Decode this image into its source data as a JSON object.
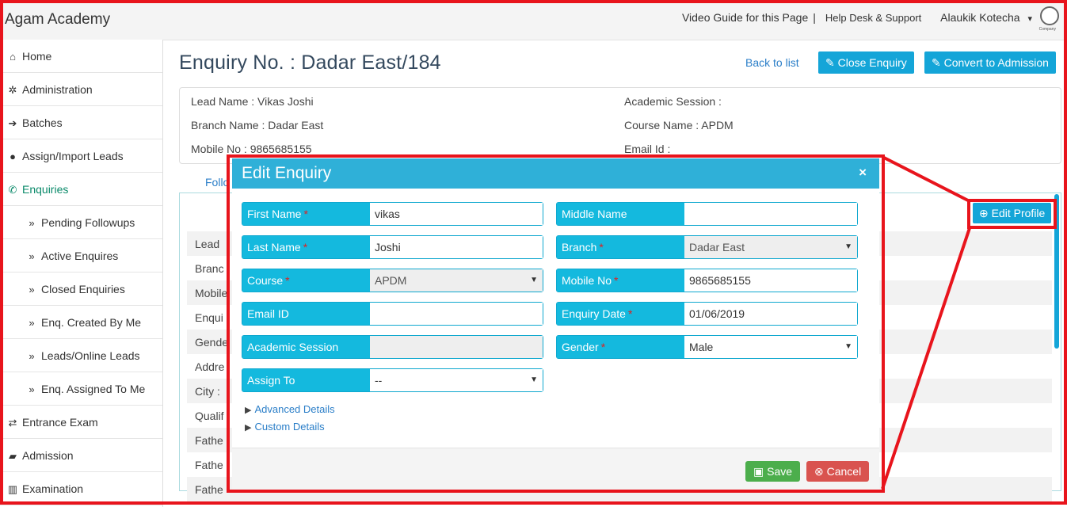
{
  "header": {
    "brand": "Agam Academy",
    "video_guide": "Video Guide for this Page",
    "separator": "|",
    "help": "Help Desk & Support",
    "user": "Alaukik Kotecha",
    "user_caret": "▾",
    "logo_caption": "Company"
  },
  "sidebar": {
    "items": [
      {
        "label": "Home",
        "icon": "home-icon",
        "glyph": "⌂"
      },
      {
        "label": "Administration",
        "icon": "gear-icon",
        "glyph": "✲"
      },
      {
        "label": "Batches",
        "icon": "sign-in-icon",
        "glyph": "➔"
      },
      {
        "label": "Assign/Import Leads",
        "icon": "user-icon",
        "glyph": "●"
      },
      {
        "label": "Enquiries",
        "icon": "phone-icon",
        "glyph": "✆"
      },
      {
        "label": "Pending Followups",
        "icon": "chevron-double-right-icon",
        "glyph": "»"
      },
      {
        "label": "Active Enquires",
        "icon": "chevron-double-right-icon",
        "glyph": "»"
      },
      {
        "label": "Closed Enquiries",
        "icon": "chevron-double-right-icon",
        "glyph": "»"
      },
      {
        "label": "Enq. Created By Me",
        "icon": "chevron-double-right-icon",
        "glyph": "»"
      },
      {
        "label": "Leads/Online Leads",
        "icon": "chevron-double-right-icon",
        "glyph": "»"
      },
      {
        "label": "Enq. Assigned To Me",
        "icon": "chevron-double-right-icon",
        "glyph": "»"
      },
      {
        "label": "Entrance Exam",
        "icon": "exchange-icon",
        "glyph": "⇄"
      },
      {
        "label": "Admission",
        "icon": "book-icon",
        "glyph": "▰"
      },
      {
        "label": "Examination",
        "icon": "bar-chart-icon",
        "glyph": "▥"
      }
    ]
  },
  "page": {
    "title": "Enquiry No. : Dadar East/184",
    "back": "Back to list",
    "close_enquiry": "Close Enquiry",
    "convert": "Convert to Admission",
    "lead_name": "Lead Name : Vikas Joshi",
    "branch_name": "Branch Name : Dadar East",
    "mobile_no": "Mobile No : 9865685155",
    "academic_session": "Academic Session :",
    "course_name": "Course Name : APDM",
    "email_id": "Email Id :",
    "tab_fragment": "Follo",
    "edit_profile": "Edit Profile",
    "row_labels": [
      "Lead",
      "Branc",
      "Mobile",
      "Enqui",
      "Gende",
      "Addre",
      "City :",
      "Qualif",
      "Fathe",
      "Fathe",
      "Fathe"
    ]
  },
  "modal": {
    "title": "Edit Enquiry",
    "close": "×",
    "fields": {
      "first_name": {
        "label": "First Name",
        "value": "vikas"
      },
      "middle_name": {
        "label": "Middle Name",
        "value": ""
      },
      "last_name": {
        "label": "Last Name",
        "value": "Joshi"
      },
      "branch": {
        "label": "Branch",
        "value": "Dadar East"
      },
      "course": {
        "label": "Course",
        "value": "APDM"
      },
      "mobile_no": {
        "label": "Mobile No",
        "value": "9865685155"
      },
      "email_id": {
        "label": "Email ID",
        "value": ""
      },
      "enquiry_date": {
        "label": "Enquiry Date",
        "value": "01/06/2019"
      },
      "academic_session": {
        "label": "Academic Session",
        "value": ""
      },
      "gender": {
        "label": "Gender",
        "value": "Male"
      },
      "assign_to": {
        "label": "Assign To",
        "value": "--"
      }
    },
    "required_mark": "*",
    "advanced": "Advanced Details",
    "custom": "Custom Details",
    "save": "Save",
    "cancel": "Cancel"
  },
  "colors": {
    "accent": "#14a5d8",
    "highlight": "#e8141c",
    "save": "#4cae4c",
    "cancel": "#d9534f"
  }
}
